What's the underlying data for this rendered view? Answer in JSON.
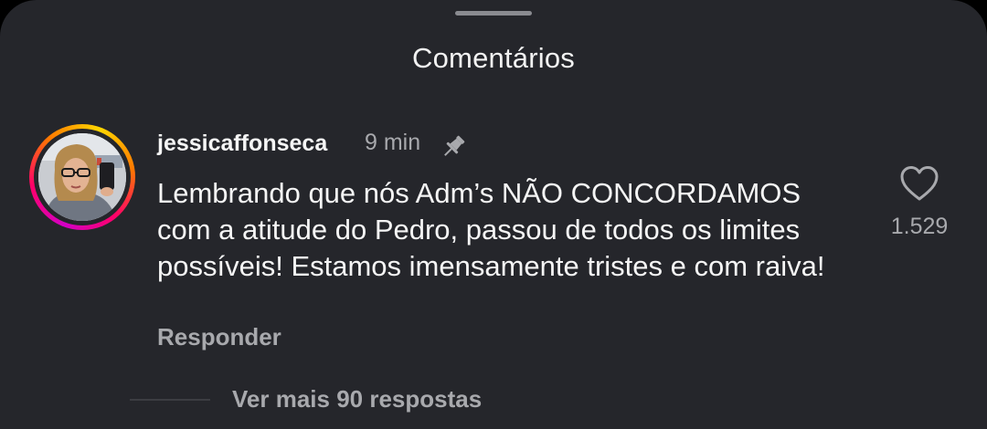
{
  "sheet": {
    "title": "Comentários"
  },
  "comment": {
    "username": "jessicaffonseca",
    "time": "9 min",
    "text": "Lembrando que nós Adm’s NÃO CONCORDAMOS com a atitude do Pedro, passou de todos os limites possíveis! Estamos imensamente tristes e com raiva!",
    "reply_label": "Responder",
    "like_count": "1.529",
    "view_replies_label": "Ver mais 90 respostas",
    "pinned": true
  },
  "icons": {
    "pin": "pin-icon",
    "like": "heart-outline-icon"
  },
  "colors": {
    "background": "#25262b",
    "primary_text": "#f5f5f5",
    "secondary_text": "#a8a9ad",
    "story_ring": [
      "#d300c5",
      "#ff0069",
      "#ff7a00",
      "#ffd600"
    ]
  }
}
